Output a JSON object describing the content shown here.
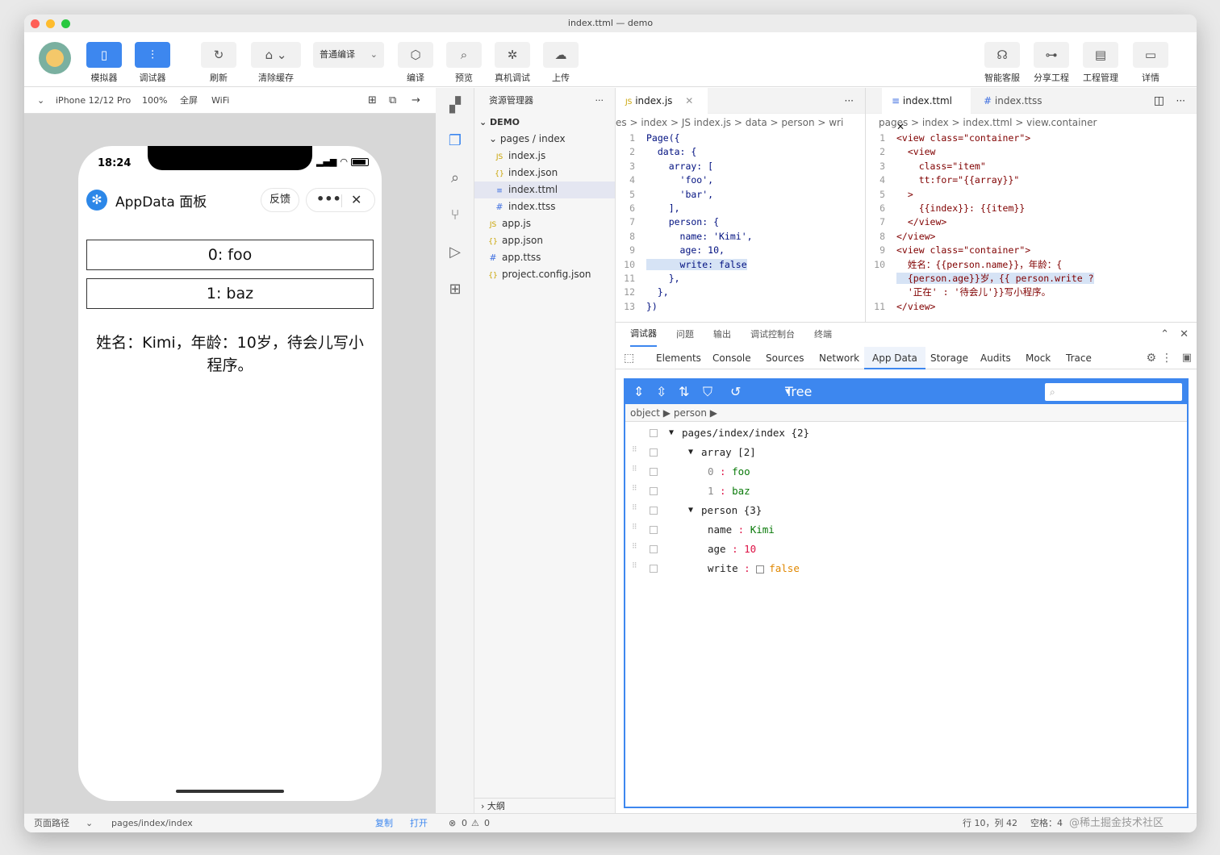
{
  "window": {
    "title": "index.ttml — demo"
  },
  "toolbar": {
    "simulator": "模拟器",
    "debugger": "调试器",
    "refresh": "刷新",
    "clear_cache": "清除缓存",
    "compile_mode": "普通编译",
    "compile": "编译",
    "preview": "预览",
    "real_debug": "真机调试",
    "upload": "上传",
    "support": "智能客服",
    "share": "分享工程",
    "project_mgmt": "工程管理",
    "details": "详情"
  },
  "device_bar": {
    "device": "iPhone 12/12 Pro",
    "zoom": "100%",
    "fullscreen": "全屏",
    "network": "WiFi"
  },
  "phone": {
    "time": "18:24",
    "title": "AppData 面板",
    "feedback": "反馈",
    "items": [
      "0: foo",
      "1: baz"
    ],
    "text": "姓名：Kimi，年龄：10岁，待会儿写小程序。"
  },
  "bottom": {
    "path_label": "页面路径",
    "path": "pages/index/index",
    "copy": "复制",
    "open": "打开",
    "errors": "0",
    "warnings": "0",
    "cursor": "行 10，列 42",
    "spaces": "空格：4",
    "watermark": "@稀土掘金技术社区"
  },
  "explorer": {
    "title": "资源管理器",
    "root": "DEMO",
    "folder": "pages / index",
    "files": [
      {
        "type": "JS",
        "name": "index.js",
        "sel": false,
        "indent": 1
      },
      {
        "type": "{}",
        "name": "index.json",
        "sel": false,
        "indent": 1
      },
      {
        "type": "≡",
        "name": "index.ttml",
        "sel": true,
        "indent": 1
      },
      {
        "type": "#",
        "name": "index.ttss",
        "sel": false,
        "indent": 1
      },
      {
        "type": "JS",
        "name": "app.js",
        "sel": false,
        "indent": 0
      },
      {
        "type": "{}",
        "name": "app.json",
        "sel": false,
        "indent": 0
      },
      {
        "type": "#",
        "name": "app.ttss",
        "sel": false,
        "indent": 0
      },
      {
        "type": "{}",
        "name": "project.config.json",
        "sel": false,
        "indent": 0
      }
    ],
    "outline": "大纲"
  },
  "editor_left": {
    "tab": "index.js",
    "crumb": "es > index > JS index.js > data > person > wri",
    "lines": [
      {
        "n": "1",
        "html": "Page({"
      },
      {
        "n": "2",
        "html": "  data: {"
      },
      {
        "n": "3",
        "html": "    array: ["
      },
      {
        "n": "4",
        "html": "      'foo',"
      },
      {
        "n": "5",
        "html": "      'bar',"
      },
      {
        "n": "6",
        "html": "    ],"
      },
      {
        "n": "7",
        "html": "    person: {"
      },
      {
        "n": "8",
        "html": "      name: 'Kimi',"
      },
      {
        "n": "9",
        "html": "      age: 10,"
      },
      {
        "n": "10",
        "html": "      write: false",
        "hl": true
      },
      {
        "n": "11",
        "html": "    },"
      },
      {
        "n": "12",
        "html": "  },"
      },
      {
        "n": "13",
        "html": "})"
      }
    ]
  },
  "editor_right": {
    "tab1": "index.ttml",
    "tab2": "index.ttss",
    "crumb": "pages > index > index.ttml > view.container",
    "lines": [
      {
        "n": "1",
        "html": "<view class=\"container\">"
      },
      {
        "n": "2",
        "html": "  <view"
      },
      {
        "n": "3",
        "html": "    class=\"item\""
      },
      {
        "n": "4",
        "html": "    tt:for=\"{{array}}\""
      },
      {
        "n": "5",
        "html": "  >"
      },
      {
        "n": "6",
        "html": "    {{index}}: {{item}}"
      },
      {
        "n": "7",
        "html": "  </view>"
      },
      {
        "n": "8",
        "html": "</view>"
      },
      {
        "n": "9",
        "html": "<view class=\"container\">"
      },
      {
        "n": "10",
        "html": "  姓名：{{person.name}}，年龄：{"
      },
      {
        "n": "",
        "html": "  {person.age}}岁，{{ person.write ?",
        "hl": true
      },
      {
        "n": "",
        "html": "  '正在' : '待会儿'}}写小程序。"
      },
      {
        "n": "11",
        "html": "</view>"
      }
    ]
  },
  "devtools": {
    "top_tabs": [
      "调试器",
      "问题",
      "输出",
      "调试控制台",
      "终端"
    ],
    "tabs": [
      "Elements",
      "Console",
      "Sources",
      "Network",
      "App Data",
      "Storage",
      "Audits",
      "Mock",
      "Trace"
    ],
    "active_tab": "App Data",
    "tree_mode": "Tree",
    "crumb": "object ▶ person ▶",
    "tree": [
      {
        "depth": 0,
        "arrow": "▼",
        "key": "pages/index/index",
        "val": "{2}",
        "cls": ""
      },
      {
        "depth": 1,
        "arrow": "▼",
        "key": "array",
        "val": "[2]",
        "cls": ""
      },
      {
        "depth": 2,
        "arrow": "",
        "key": "0",
        "val": "foo",
        "cls": "gr"
      },
      {
        "depth": 2,
        "arrow": "",
        "key": "1",
        "val": "baz",
        "cls": "gr"
      },
      {
        "depth": 1,
        "arrow": "▼",
        "key": "person",
        "val": "{3}",
        "cls": ""
      },
      {
        "depth": 2,
        "arrow": "",
        "key": "name",
        "val": "Kimi",
        "cls": "gr"
      },
      {
        "depth": 2,
        "arrow": "",
        "key": "age",
        "val": "10",
        "cls": "rd"
      },
      {
        "depth": 2,
        "arrow": "",
        "key": "write",
        "val": "false",
        "cls": "or",
        "checkbox": true
      }
    ]
  }
}
